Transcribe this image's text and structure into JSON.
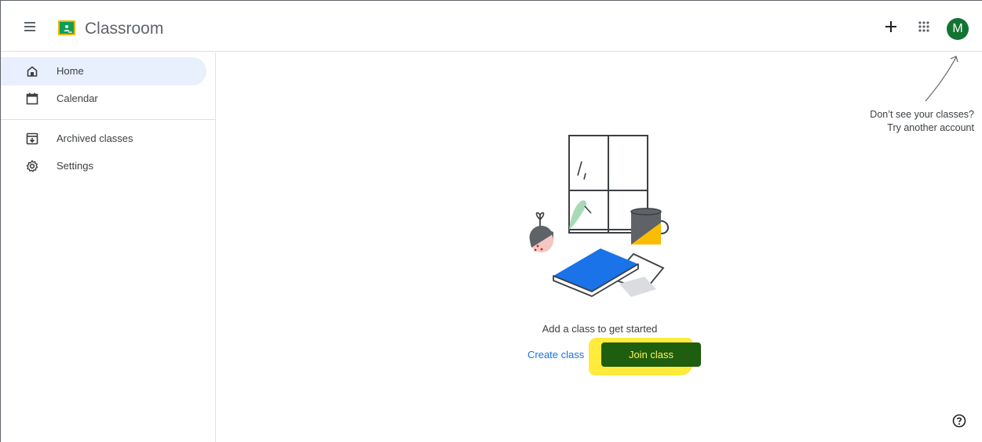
{
  "header": {
    "title": "Classroom",
    "avatar_initial": "M",
    "icons": {
      "menu": "menu-icon",
      "logo": "classroom-logo-icon",
      "add": "plus-icon",
      "apps": "apps-grid-icon"
    }
  },
  "sidebar": {
    "items": [
      {
        "label": "Home",
        "icon": "home-icon",
        "active": true
      },
      {
        "label": "Calendar",
        "icon": "calendar-icon",
        "active": false
      },
      {
        "label": "Archived classes",
        "icon": "archive-icon",
        "active": false
      },
      {
        "label": "Settings",
        "icon": "gear-icon",
        "active": false
      }
    ]
  },
  "main": {
    "empty_state_title": "Add a class to get started",
    "create_class_label": "Create class",
    "join_class_label": "Join class"
  },
  "account_hint": {
    "line1": "Don’t see your classes?",
    "line2": "Try another account"
  },
  "colors": {
    "accent_blue": "#1a73e8",
    "active_nav_bg": "#e8f0fe",
    "avatar_green": "#137333",
    "join_button_bg": "#1e5e0f",
    "highlight_yellow": "#ffeb3b"
  }
}
